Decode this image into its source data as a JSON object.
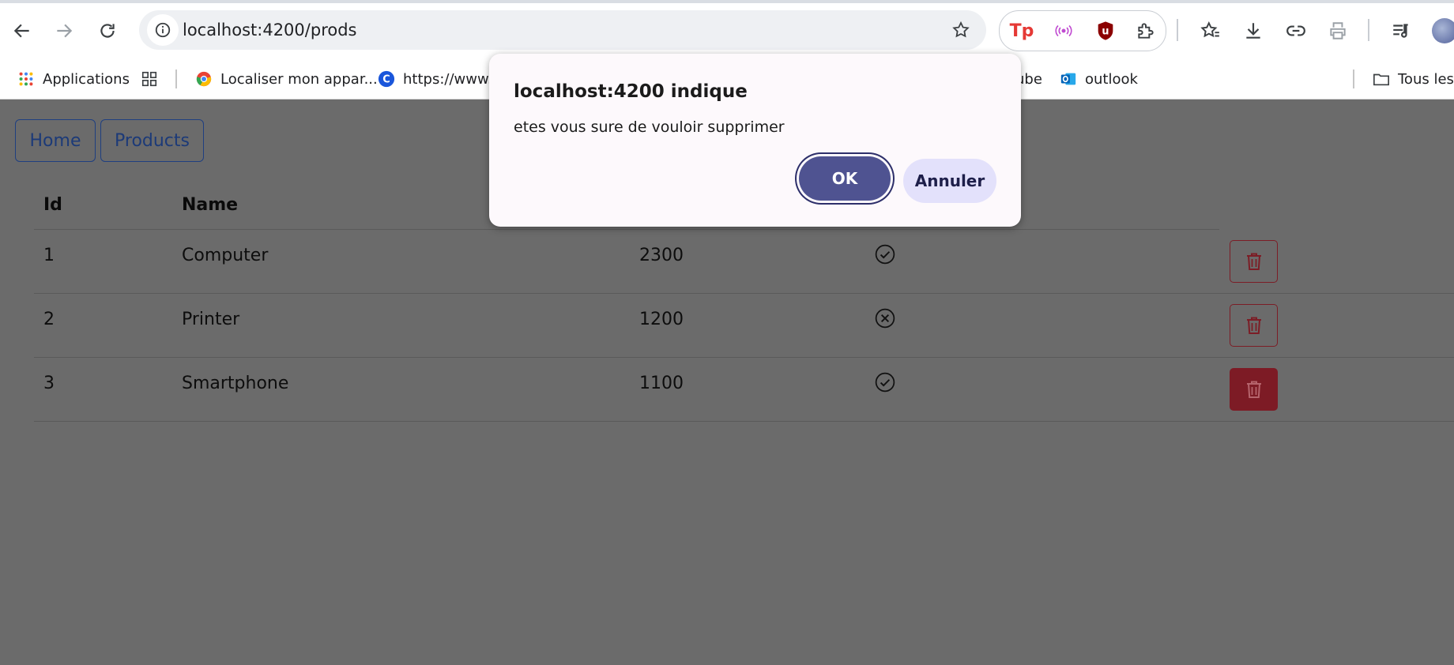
{
  "browser": {
    "url": "localhost:4200/prods",
    "bookmarks": [
      {
        "label": "Applications",
        "icon": "apps-grid-icon"
      },
      {
        "label": "",
        "icon": "tab-groups-icon"
      },
      {
        "label": "Localiser mon appar...",
        "icon": "google-chrome-icon"
      },
      {
        "label": "https://www.c",
        "icon": "c-logo-icon"
      },
      {
        "label": "ube",
        "icon": "youtube-icon"
      },
      {
        "label": "outlook",
        "icon": "outlook-icon"
      },
      {
        "label": "Tous les",
        "icon": "folder-icon"
      }
    ]
  },
  "nav": {
    "home_label": "Home",
    "products_label": "Products"
  },
  "table": {
    "headers": [
      "Id",
      "Name"
    ],
    "rows": [
      {
        "id": "1",
        "name": "Computer",
        "price": "2300",
        "selected": true
      },
      {
        "id": "2",
        "name": "Printer",
        "price": "1200",
        "selected": false
      },
      {
        "id": "3",
        "name": "Smartphone",
        "price": "1100",
        "selected": true
      }
    ]
  },
  "dialog": {
    "title": "localhost:4200 indique",
    "message": "etes vous sure de vouloir supprimer",
    "ok_label": "OK",
    "cancel_label": "Annuler"
  },
  "colors": {
    "overlay": "#6b6b6b",
    "danger": "#7d1b25",
    "primary_button": "#4f5391",
    "secondary_button": "#e3e1fb",
    "nav_outline": "#1f3f80"
  }
}
